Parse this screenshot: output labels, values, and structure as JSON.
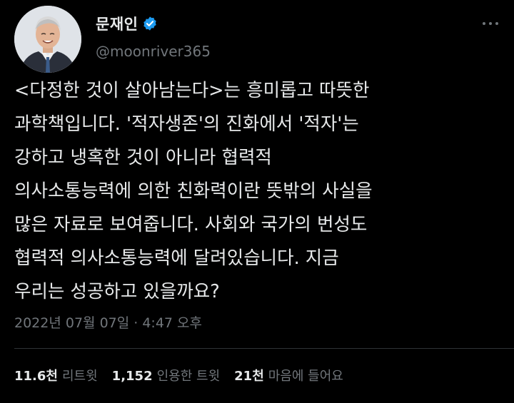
{
  "author": {
    "name": "문재인",
    "handle": "@moonriver365",
    "verified_color": "#1d9bf0",
    "avatar_icon": "profile-photo"
  },
  "tweet": {
    "lines": [
      "<다정한 것이 살아남는다>는 흥미롭고 따뜻한",
      "과학책입니다. '적자생존'의 진화에서 '적자'는",
      "강하고 냉혹한 것이 아니라 협력적",
      "의사소통능력에 의한 친화력이란 뜻밖의 사실을",
      "많은 자료로 보여줍니다. 사회와 국가의 번성도",
      "협력적 의사소통능력에 달려있습니다. 지금",
      "우리는 성공하고 있을까요?"
    ],
    "timestamp": "2022년 07월 07일 · 4:47 오후"
  },
  "stats": {
    "retweets": {
      "count": "11.6천",
      "label": "리트윗"
    },
    "quotes": {
      "count": "1,152",
      "label": "인용한 트윗"
    },
    "likes": {
      "count": "21천",
      "label": "마음에 들어요"
    }
  },
  "colors": {
    "background": "#000000",
    "text": "#e7e9ea",
    "secondary_text": "#71767b",
    "divider": "#2f3336"
  },
  "icons": [
    "verified-badge-icon",
    "more-options-icon"
  ]
}
